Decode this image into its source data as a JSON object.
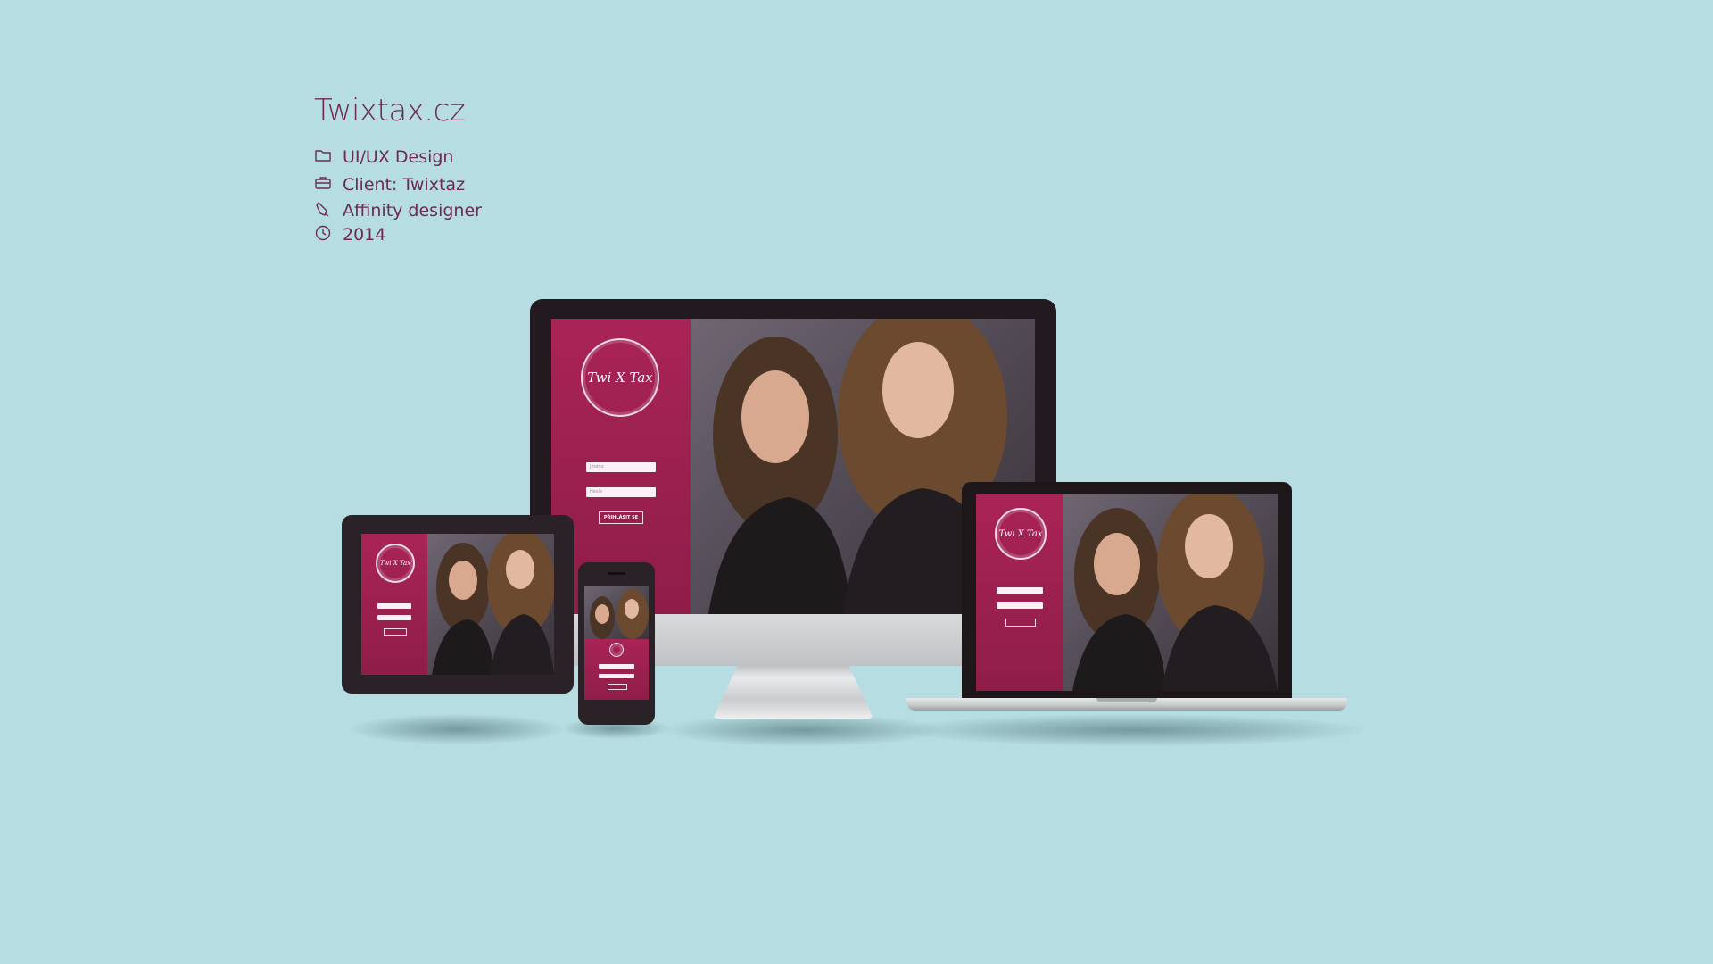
{
  "project": {
    "title": "Twixtax.cz",
    "details": [
      {
        "icon": "folder-icon",
        "text": "UI/UX Design"
      },
      {
        "icon": "briefcase-icon",
        "text": "Client: Twixtaz"
      },
      {
        "icon": "pen-icon",
        "text": "Affinity designer"
      },
      {
        "icon": "clock-icon",
        "text": "2014"
      }
    ]
  },
  "mockup": {
    "logo_text": "Twi X Tax",
    "login": {
      "username_placeholder": "Jméno",
      "password_placeholder": "Heslo",
      "submit_label": "PŘIHLÁSIT SE"
    }
  },
  "colors": {
    "background": "#b6dee2",
    "text": "#6e2a4f",
    "brand_panel": "#a92456",
    "device_frame": "#2a2226"
  }
}
